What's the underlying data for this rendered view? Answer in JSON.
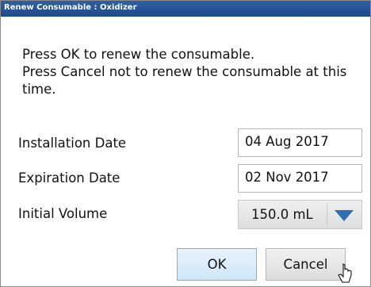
{
  "dialog": {
    "title": "Renew Consumable : Oxidizer",
    "message_lines": [
      "Press OK to renew the consumable.",
      "Press Cancel not to renew the consumable at this",
      "time."
    ]
  },
  "fields": {
    "installation_date": {
      "label": "Installation Date",
      "value": "04 Aug 2017"
    },
    "expiration_date": {
      "label": "Expiration Date",
      "value": "02 Nov 2017"
    },
    "initial_volume": {
      "label": "Initial Volume",
      "value": "150.0 mL"
    }
  },
  "buttons": {
    "ok": "OK",
    "cancel": "Cancel"
  },
  "icons": {
    "dropdown": "chevron-down-icon",
    "cursor": "mouse-pointer-icon"
  },
  "colors": {
    "title_bar": "#1f4a8a",
    "dropdown_arrow": "#2f6fb2",
    "ok_button": "#cfe6f8"
  }
}
